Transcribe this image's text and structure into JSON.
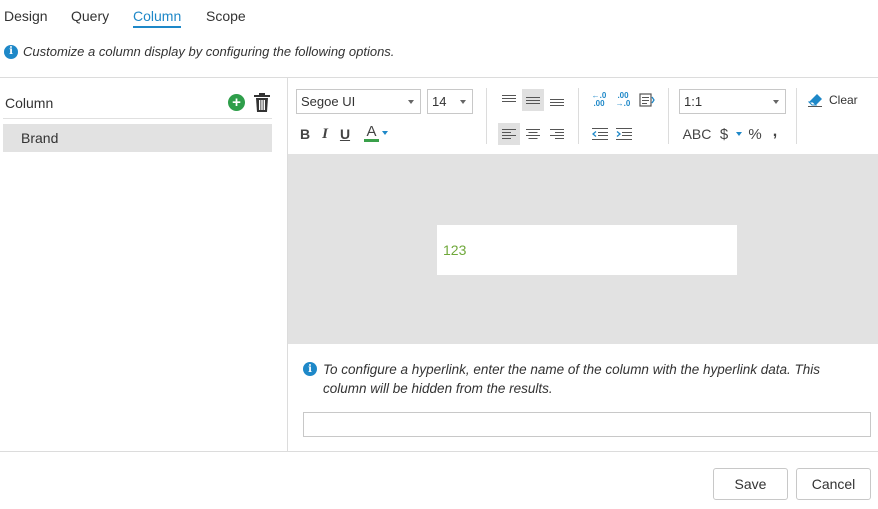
{
  "tabs": [
    {
      "label": "Design"
    },
    {
      "label": "Query"
    },
    {
      "label": "Column"
    },
    {
      "label": "Scope"
    }
  ],
  "active_tab": "Column",
  "info_text": "Customize a column display by configuring the following options.",
  "columns": {
    "header": "Column",
    "items": [
      {
        "label": "Brand"
      }
    ]
  },
  "toolbar": {
    "font_family": "Segoe UI",
    "font_size": "14",
    "ratio": "1:1",
    "clear_label": "Clear",
    "abc_label": "ABC",
    "currency_symbol": "$",
    "percent_symbol": "%",
    "comma_symbol": ",",
    "bold": "B",
    "italic": "I",
    "underline": "U",
    "font_color": "A",
    "decimal_increase": "←.0 .00",
    "decimal_decrease": ".00 →.0"
  },
  "preview": {
    "value": "123",
    "text_color": "#6fa83a"
  },
  "hyperlink": {
    "info": "To configure a hyperlink, enter the name of the column with the hyperlink data. This column will be hidden from the results.",
    "value": ""
  },
  "buttons": {
    "save": "Save",
    "cancel": "Cancel"
  },
  "colors": {
    "accent": "#1e88c8",
    "add": "#2e9e4a",
    "font_color_underline": "#3aa04a"
  }
}
